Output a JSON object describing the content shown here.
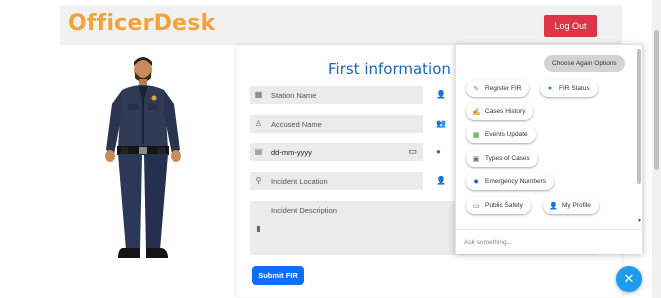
{
  "header": {
    "brand": "OfficerDesk",
    "logout_label": "Log Out"
  },
  "form": {
    "title": "First information r",
    "station_placeholder": "Station Name",
    "accused_placeholder": "Accused Name",
    "date_placeholder": "dd-mm-yyyy",
    "location_placeholder": "Incident Location",
    "description_placeholder": "Incident Description",
    "submit_label": "Submit FIR"
  },
  "chat": {
    "choose_again_label": "Choose Again Options",
    "options": [
      {
        "label": "Register FIR",
        "icon": "register-icon"
      },
      {
        "label": "FIR Status",
        "icon": "status-icon"
      },
      {
        "label": "Cases History",
        "icon": "history-icon"
      },
      {
        "label": "Events Update",
        "icon": "events-icon"
      },
      {
        "label": "Types of Cases",
        "icon": "case-types-icon"
      },
      {
        "label": "Emergency Numbers",
        "icon": "emergency-icon"
      },
      {
        "label": "Public Safety",
        "icon": "safety-icon"
      },
      {
        "label": "My Profile",
        "icon": "profile-icon"
      }
    ],
    "input_placeholder": "Ask something..."
  },
  "colors": {
    "brand": "#f2a33a",
    "logout": "#dc3545",
    "title": "#1667c9",
    "submit": "#0d6efd",
    "fab": "#1e9bf0"
  }
}
